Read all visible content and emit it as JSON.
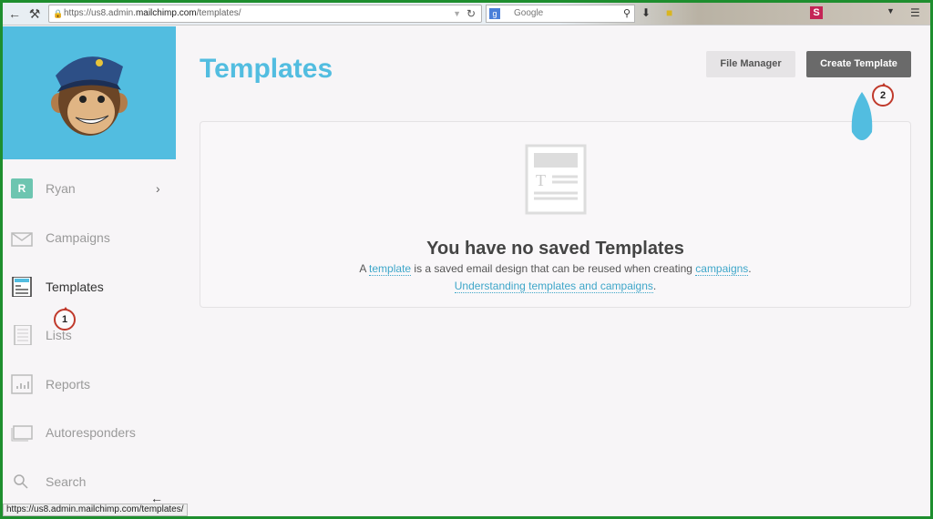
{
  "browser": {
    "url_prefix": "https://us8.admin.",
    "url_domain": "mailchimp.com",
    "url_path": "/templates/",
    "search_placeholder": "Google",
    "status_url": "https://us8.admin.mailchimp.com/templates/"
  },
  "sidebar": {
    "user": {
      "initial": "R",
      "name": "Ryan"
    },
    "items": [
      {
        "label": "Campaigns"
      },
      {
        "label": "Templates"
      },
      {
        "label": "Lists"
      },
      {
        "label": "Reports"
      },
      {
        "label": "Autoresponders"
      },
      {
        "label": "Search"
      }
    ]
  },
  "main": {
    "title": "Templates",
    "file_manager": "File Manager",
    "create_template": "Create Template",
    "empty": {
      "heading": "You have no saved Templates",
      "line_a": "A ",
      "link_template": "template",
      "line_b": " is a saved email design that can be reused when creating ",
      "link_campaigns": "campaigns",
      "line_c": ".",
      "link_understanding": "Understanding templates and campaigns",
      "line_d": "."
    }
  },
  "markers": [
    "1",
    "2"
  ],
  "colors": {
    "accent": "#52bde0",
    "avatar": "#6dc5b0",
    "create_button": "#6a6a6a",
    "frame": "#1e8e2e"
  }
}
